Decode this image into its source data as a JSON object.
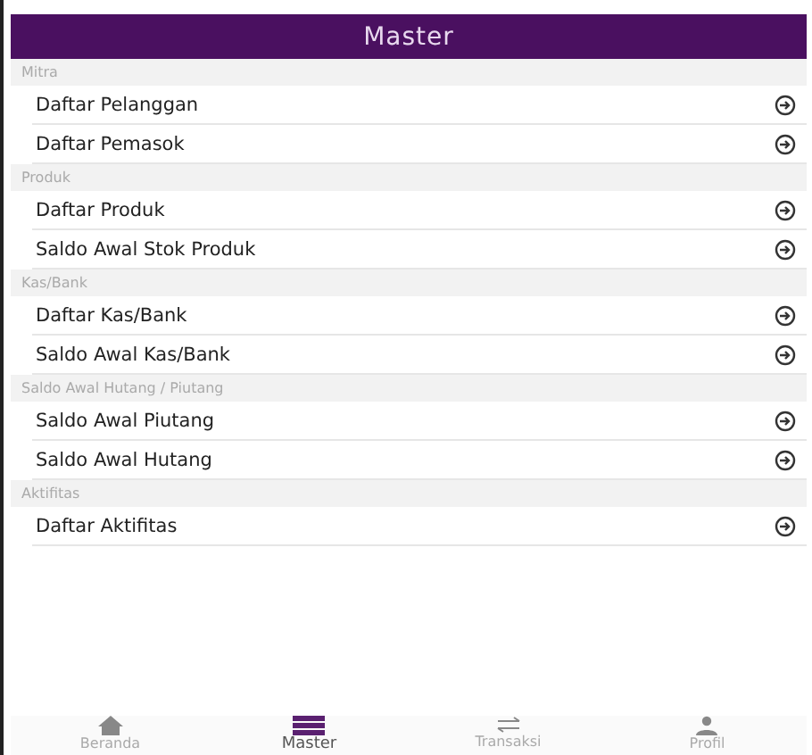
{
  "header": {
    "title": "Master"
  },
  "sections": [
    {
      "title": "Mitra",
      "items": [
        "Daftar Pelanggan",
        "Daftar Pemasok"
      ]
    },
    {
      "title": "Produk",
      "items": [
        "Daftar Produk",
        "Saldo Awal Stok Produk"
      ]
    },
    {
      "title": "Kas/Bank",
      "items": [
        "Daftar Kas/Bank",
        "Saldo Awal Kas/Bank"
      ]
    },
    {
      "title": "Saldo Awal Hutang / Piutang",
      "items": [
        "Saldo Awal Piutang",
        "Saldo Awal Hutang"
      ]
    },
    {
      "title": "Aktifitas",
      "items": [
        "Daftar Aktifitas"
      ]
    }
  ],
  "tabs": [
    {
      "label": "Beranda",
      "kind": "home",
      "selected": false
    },
    {
      "label": "Master",
      "kind": "list",
      "selected": true
    },
    {
      "label": "Transaksi",
      "kind": "swap",
      "selected": false
    },
    {
      "label": "Profil",
      "kind": "person",
      "selected": false
    }
  ]
}
